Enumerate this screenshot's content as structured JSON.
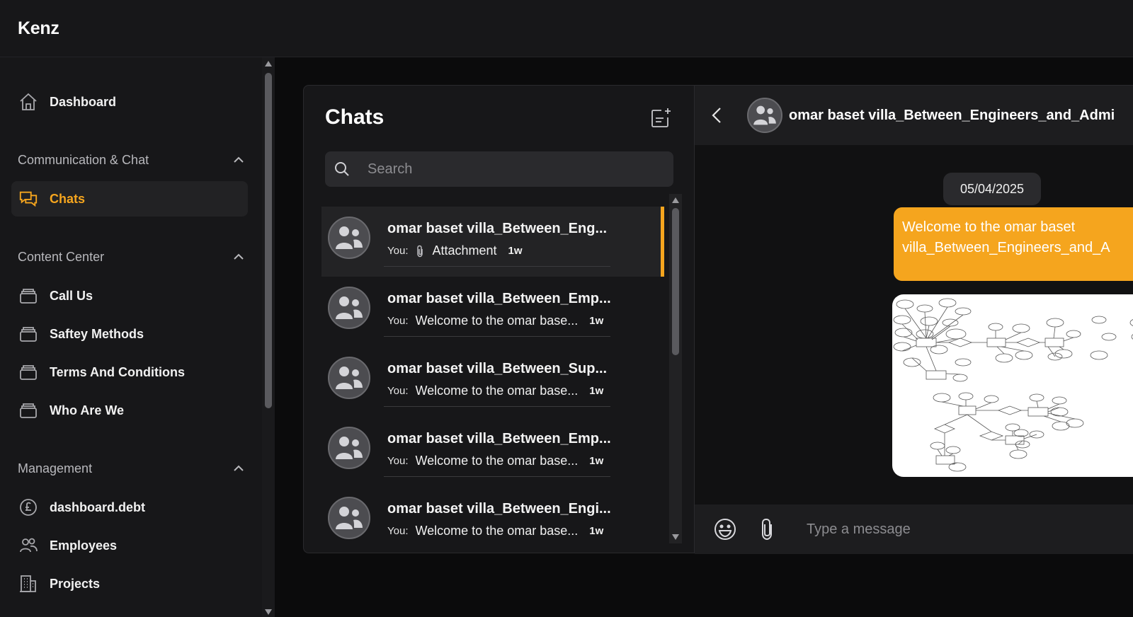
{
  "app": {
    "brand": "Kenz"
  },
  "sidebar": {
    "dashboard": {
      "label": "Dashboard",
      "icon": "home-icon"
    },
    "sections": [
      {
        "label": "Communication & Chat",
        "items": [
          {
            "label": "Chats",
            "icon": "chat-icon",
            "active": true
          }
        ]
      },
      {
        "label": "Content Center",
        "items": [
          {
            "label": "Call Us",
            "icon": "layers-icon"
          },
          {
            "label": "Saftey Methods",
            "icon": "layers-icon"
          },
          {
            "label": "Terms And Conditions",
            "icon": "layers-icon"
          },
          {
            "label": "Who Are We",
            "icon": "layers-icon"
          }
        ]
      },
      {
        "label": "Management",
        "items": [
          {
            "label": "dashboard.debt",
            "icon": "pound-icon"
          },
          {
            "label": "Employees",
            "icon": "users-icon"
          },
          {
            "label": "Projects",
            "icon": "building-icon"
          }
        ]
      }
    ]
  },
  "chat_list": {
    "title": "Chats",
    "search_placeholder": "Search",
    "items": [
      {
        "name": "omar baset villa_Between_Eng...",
        "prefix": "You:",
        "message": "Attachment",
        "time": "1w",
        "attachment": true,
        "selected": true
      },
      {
        "name": "omar baset villa_Between_Emp...",
        "prefix": "You:",
        "message": "Welcome to the omar base...",
        "time": "1w"
      },
      {
        "name": "omar baset villa_Between_Sup...",
        "prefix": "You:",
        "message": "Welcome to the omar base...",
        "time": "1w"
      },
      {
        "name": "omar baset villa_Between_Emp...",
        "prefix": "You:",
        "message": "Welcome to the omar base...",
        "time": "1w"
      },
      {
        "name": "omar baset villa_Between_Engi...",
        "prefix": "You:",
        "message": "Welcome to the omar base...",
        "time": "1w"
      }
    ]
  },
  "conversation": {
    "title": "omar baset villa_Between_Engineers_and_Admi",
    "date": "05/04/2025",
    "message": "Welcome to the omar baset villa_Between_Engineers_and_A",
    "composer_placeholder": "Type a message"
  },
  "colors": {
    "accent": "#f5a51e",
    "panel": "#171719",
    "background": "#0b0b0c"
  }
}
